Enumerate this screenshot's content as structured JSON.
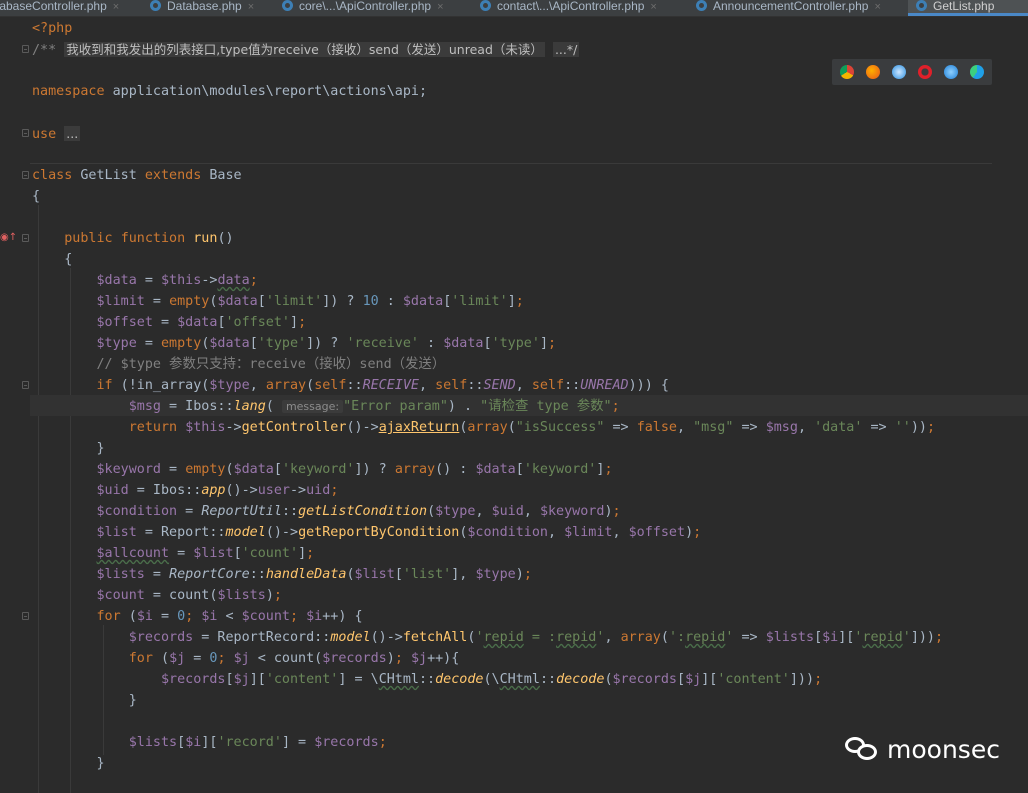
{
  "tabs": [
    {
      "label": "tabaseController.php",
      "active": false
    },
    {
      "label": "Database.php",
      "active": false
    },
    {
      "label": "core\\...\\ApiController.php",
      "active": false
    },
    {
      "label": "contact\\...\\ApiController.php",
      "active": false
    },
    {
      "label": "AnnouncementController.php",
      "active": false
    },
    {
      "label": "GetList.php",
      "active": true
    }
  ],
  "tab_close_glyph": "×",
  "editor": {
    "php_open": "<?php",
    "doc_prefix": "/**",
    "doc_comment": "我收到和我发出的列表接口,type值为receive（接收）send（发送）unread（未读）",
    "doc_suffix": "...*/",
    "namespace_kw": "namespace",
    "namespace_path": "application\\modules\\report\\actions\\api;",
    "use_kw": "use",
    "use_fold": "...",
    "class_kw": "class",
    "class_name": "GetList",
    "extends_kw": "extends",
    "base_name": "Base",
    "brace_open": "{",
    "brace_close": "}",
    "fn_public": "public",
    "fn_function": "function",
    "fn_name": "run",
    "fn_parens": "()",
    "param_hint_label": "message:",
    "comment_type": "// $type 参数只支持：receive（接收）send（发送）"
  },
  "browser_icons": [
    "chrome-icon",
    "firefox-icon",
    "safari-icon",
    "opera-icon",
    "ie-icon",
    "edge-icon"
  ],
  "watermark": {
    "text": "moonsec"
  },
  "colors": {
    "keyword": "#cc7832",
    "variable": "#9876aa",
    "string": "#6a8759",
    "number": "#6897bb",
    "comment": "#808080",
    "function": "#ffc66d",
    "tab_accent": "#4a88c7"
  }
}
